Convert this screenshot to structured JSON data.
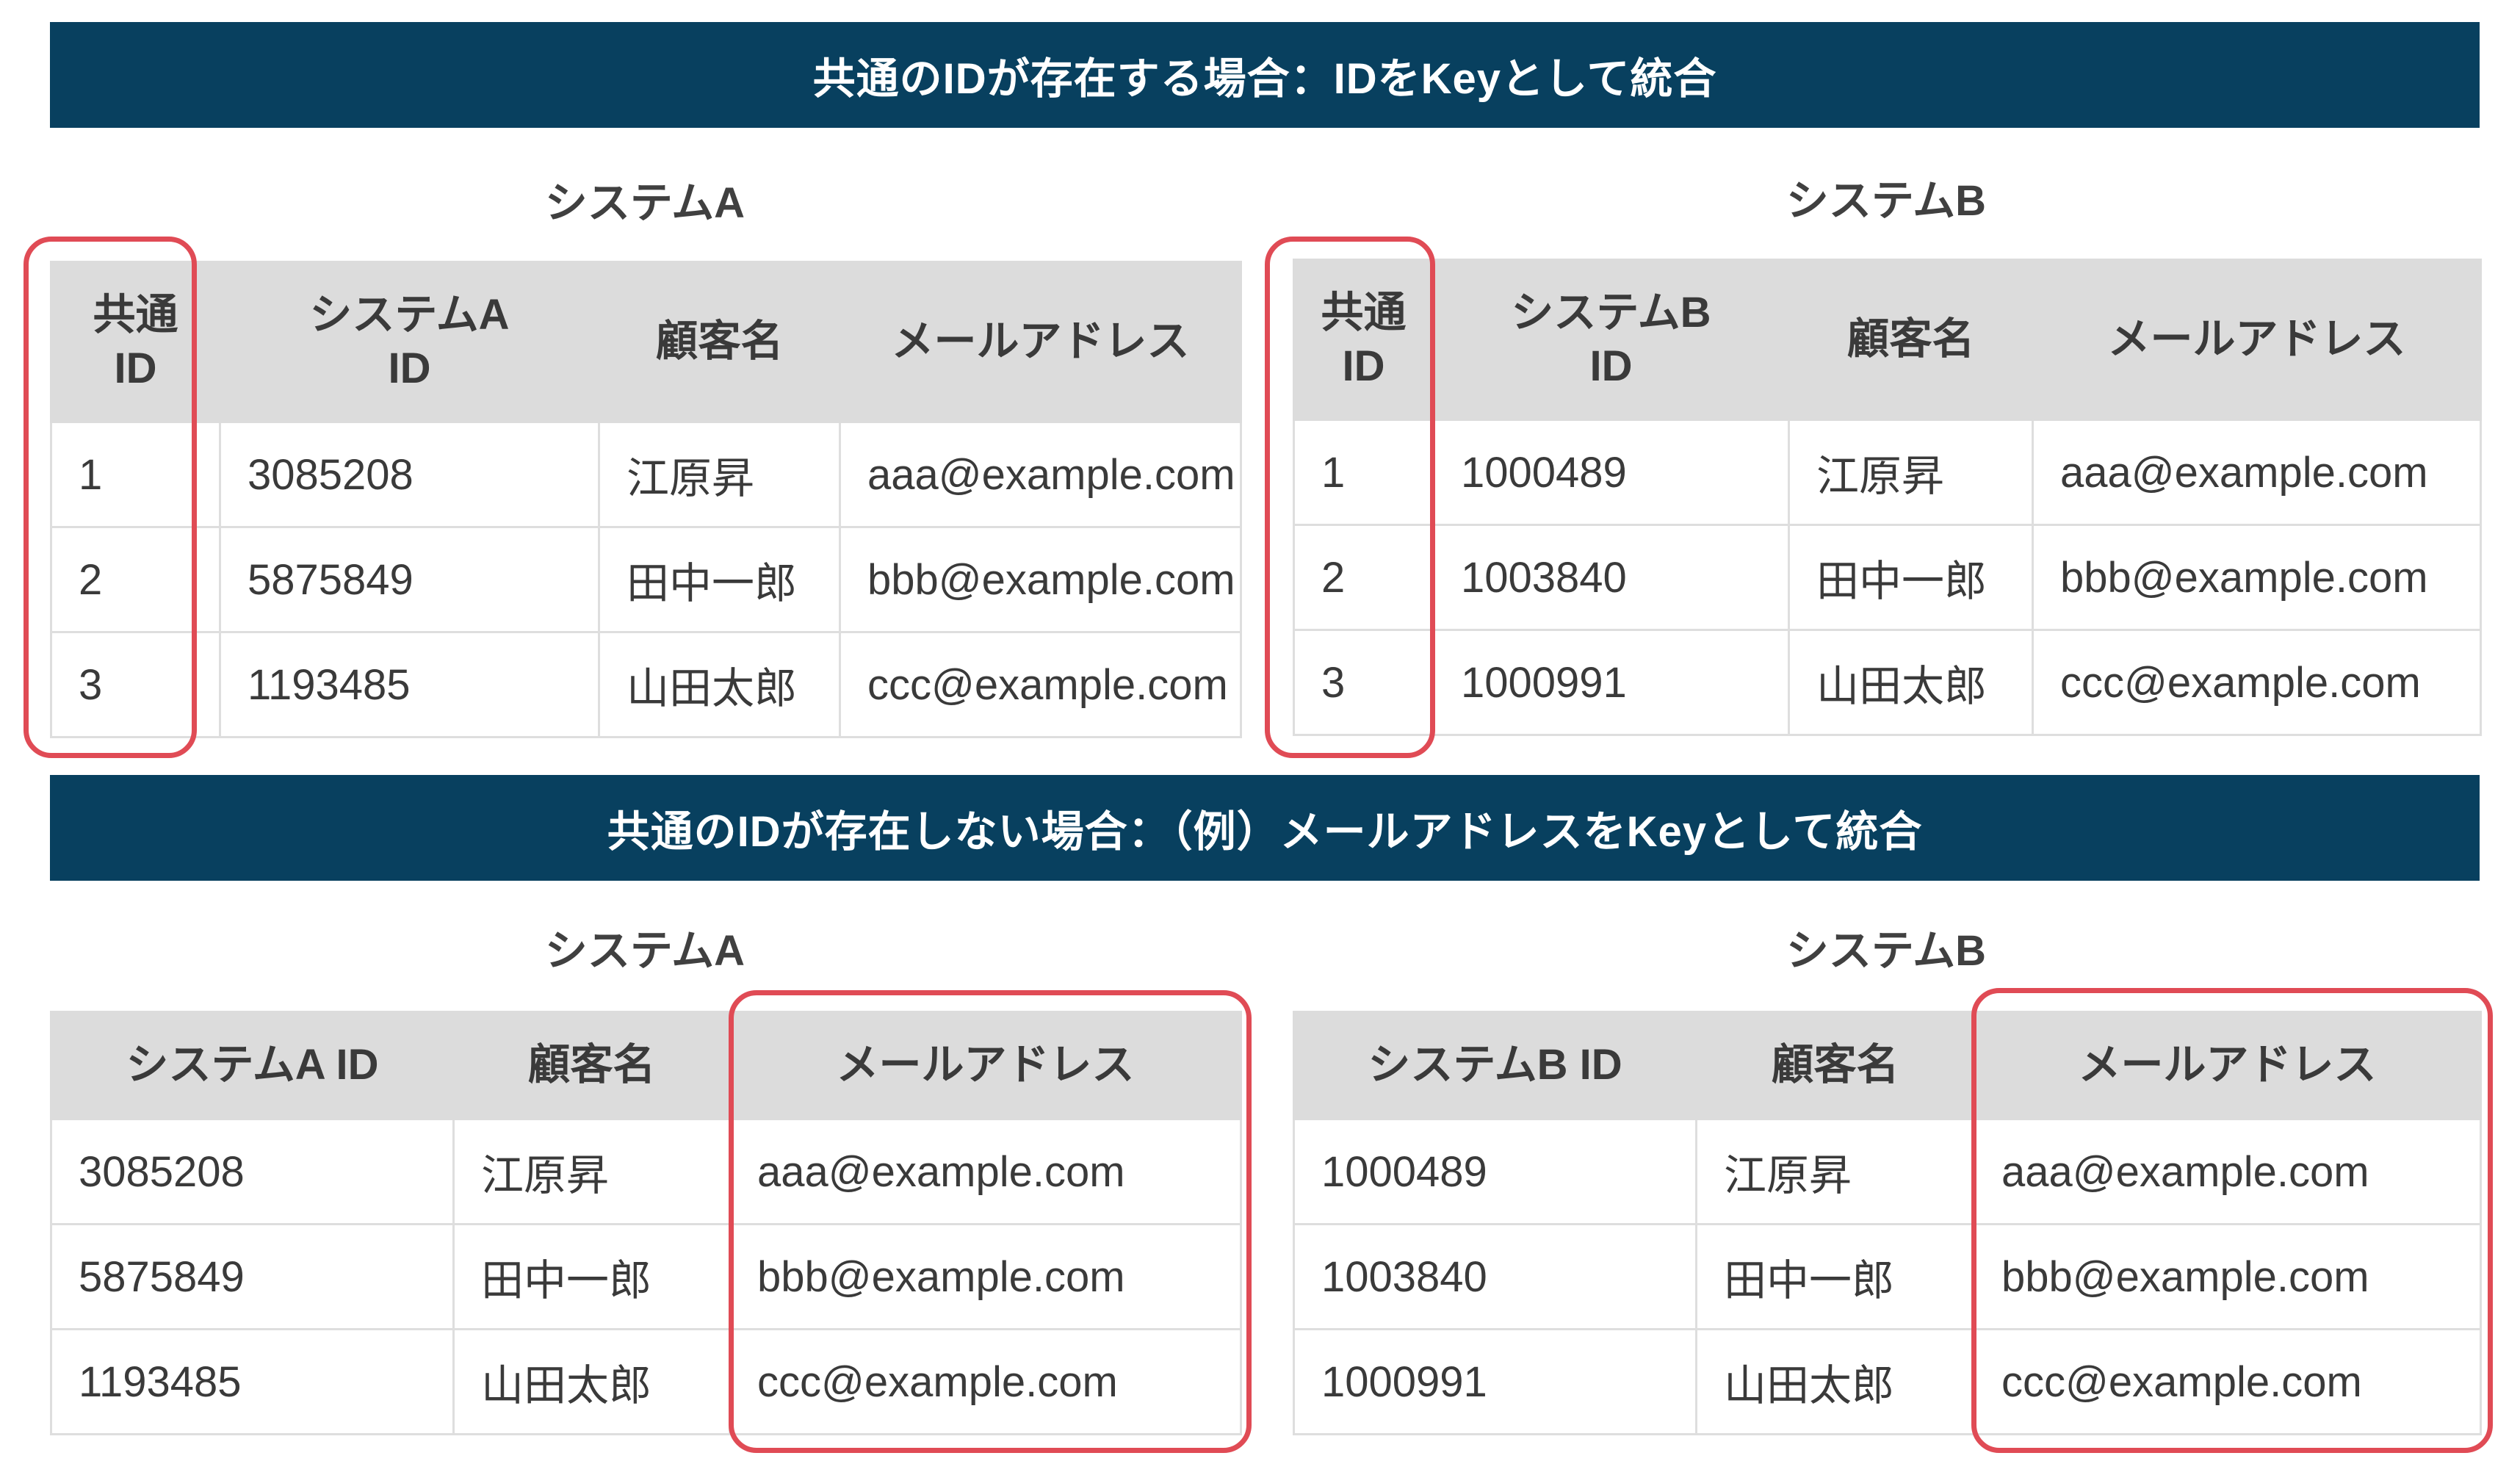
{
  "section1": {
    "title": "共通のIDが存在する場合：IDをKeyとして統合",
    "system_a": {
      "caption": "システムA",
      "headers": [
        "共通\nID",
        "システムA\nID",
        "顧客名",
        "メールアドレス"
      ],
      "rows": [
        [
          "1",
          "3085208",
          "江原昇",
          "aaa@example.com"
        ],
        [
          "2",
          "5875849",
          "田中一郎",
          "bbb@example.com"
        ],
        [
          "3",
          "1193485",
          "山田太郎",
          "ccc@example.com"
        ]
      ]
    },
    "system_b": {
      "caption": "システムB",
      "headers": [
        "共通\nID",
        "システムB\nID",
        "顧客名",
        "メールアドレス"
      ],
      "rows": [
        [
          "1",
          "1000489",
          "江原昇",
          "aaa@example.com"
        ],
        [
          "2",
          "1003840",
          "田中一郎",
          "bbb@example.com"
        ],
        [
          "3",
          "1000991",
          "山田太郎",
          "ccc@example.com"
        ]
      ]
    }
  },
  "section2": {
    "title": "共通のIDが存在しない場合：（例）メールアドレスをKeyとして統合",
    "system_a": {
      "caption": "システムA",
      "headers": [
        "システムA ID",
        "顧客名",
        "メールアドレス"
      ],
      "rows": [
        [
          "3085208",
          "江原昇",
          "aaa@example.com"
        ],
        [
          "5875849",
          "田中一郎",
          "bbb@example.com"
        ],
        [
          "1193485",
          "山田太郎",
          "ccc@example.com"
        ]
      ]
    },
    "system_b": {
      "caption": "システムB",
      "headers": [
        "システムB ID",
        "顧客名",
        "メールアドレス"
      ],
      "rows": [
        [
          "1000489",
          "江原昇",
          "aaa@example.com"
        ],
        [
          "1003840",
          "田中一郎",
          "bbb@example.com"
        ],
        [
          "1000991",
          "山田太郎",
          "ccc@example.com"
        ]
      ]
    }
  },
  "colors": {
    "banner": "#08405f",
    "header_fill": "#dcdcdc",
    "highlight": "#e04b55"
  }
}
